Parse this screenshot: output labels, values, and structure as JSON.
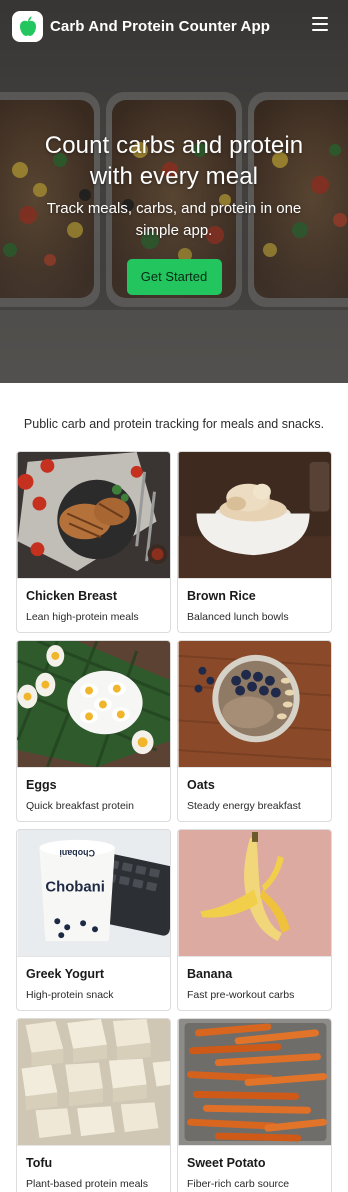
{
  "header": {
    "app_title": "Carb And Protein Counter App",
    "logo_icon": "apple-icon",
    "menu_icon": "hamburger-menu-icon"
  },
  "hero": {
    "title": "Count carbs and protein with every meal",
    "subtitle": "Track meals, carbs, and protein in one simple app.",
    "cta_label": "Get Started",
    "cta_color": "#22c55e"
  },
  "tagline": "Public carb and protein tracking for meals and snacks.",
  "foods": [
    {
      "name": "Chicken Breast",
      "desc": "Lean high-protein meals"
    },
    {
      "name": "Brown Rice",
      "desc": "Balanced lunch bowls"
    },
    {
      "name": "Eggs",
      "desc": "Quick breakfast protein"
    },
    {
      "name": "Oats",
      "desc": "Steady energy breakfast"
    },
    {
      "name": "Greek Yogurt",
      "desc": "High-protein snack"
    },
    {
      "name": "Banana",
      "desc": "Fast pre-workout carbs"
    },
    {
      "name": "Tofu",
      "desc": "Plant-based protein meals"
    },
    {
      "name": "Sweet Potato",
      "desc": "Fiber-rich carb source"
    }
  ],
  "yogurt_brand": "Chobani",
  "brand_color": "#22c55e"
}
